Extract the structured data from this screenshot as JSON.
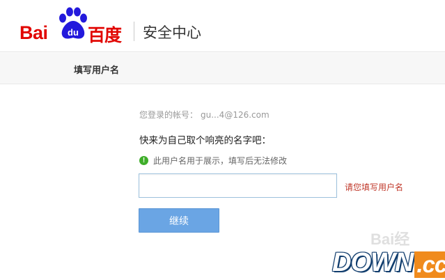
{
  "header": {
    "logo_bai": "Bai",
    "logo_du": "du",
    "logo_cn": "百度",
    "section_title": "安全中心"
  },
  "tab": {
    "label": "填写用户名"
  },
  "form": {
    "account_label": "您登录的帐号：",
    "account_value": "gu...4@126.com",
    "heading": "快来为自己取个响亮的名字吧：",
    "hint_icon": "!",
    "hint_text": "此用户名用于展示，填写后无法修改",
    "username_value": "",
    "error_text": "请您填写用户名",
    "continue_label": "继续"
  },
  "watermarks": {
    "baidu_text": "Bai经",
    "down_text": "DOWN",
    "cc_text": ".cc"
  },
  "colors": {
    "brand_red": "#e10602",
    "brand_blue": "#2319dc",
    "button_blue": "#6aa5e4",
    "error_red": "#c0392b",
    "hint_green": "#3fae2a"
  },
  "icons": [
    "baidu-paw-icon",
    "info-check-icon"
  ]
}
